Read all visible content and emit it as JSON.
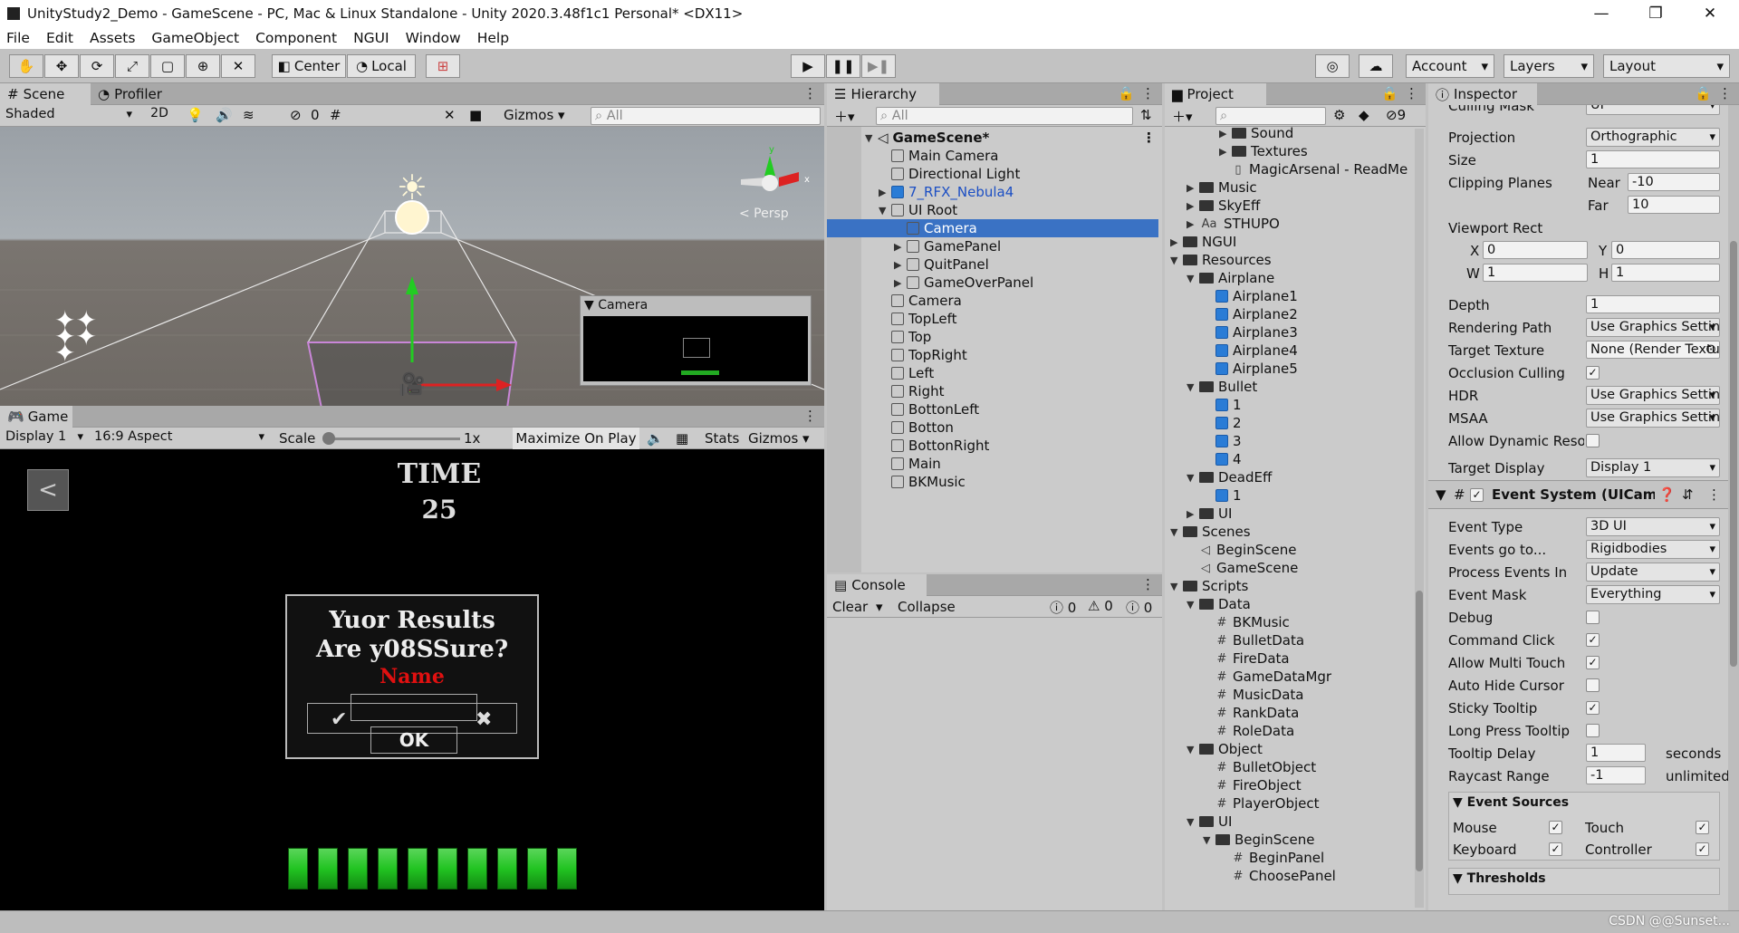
{
  "titlebar": {
    "title": "UnityStudy2_Demo - GameScene - PC, Mac & Linux Standalone - Unity 2020.3.48f1c1 Personal* <DX11>",
    "min": "—",
    "max": "❐",
    "close": "✕"
  },
  "menu": [
    "File",
    "Edit",
    "Assets",
    "GameObject",
    "Component",
    "NGUI",
    "Window",
    "Help"
  ],
  "toolbar": {
    "center": "Center",
    "local": "Local",
    "account": "Account",
    "layers": "Layers",
    "layout": "Layout",
    "play_icon": "play-icon",
    "pause_icon": "pause-icon",
    "step_icon": "step-icon"
  },
  "scene": {
    "tab_scene": "Scene",
    "tab_profiler": "Profiler",
    "shaded": "Shaded",
    "mode2d": "2D",
    "fx_count": "0",
    "gizmos": "Gizmos",
    "search_placeholder": "All",
    "persp": "< Persp",
    "camera_preview_title": "Camera"
  },
  "game": {
    "tab": "Game",
    "display": "Display 1",
    "aspect": "16:9 Aspect",
    "scale_label": "Scale",
    "scale_value": "1x",
    "maximize": "Maximize On Play",
    "stats": "Stats",
    "gizmos": "Gizmos",
    "time_label": "TIME",
    "time_value": "25",
    "results_line1": "Yuor Results",
    "results_line2": "Are y08SSure?",
    "name_label": "Name",
    "ok": "OK",
    "bars_filled": 10
  },
  "hierarchy": {
    "tab": "Hierarchy",
    "search_placeholder": "All",
    "scene_name": "GameScene*",
    "items": [
      {
        "label": "Main Camera",
        "depth": 1,
        "exp": "",
        "icon": "cube"
      },
      {
        "label": "Directional Light",
        "depth": 1,
        "exp": "",
        "icon": "cube"
      },
      {
        "label": "7_RFX_Nebula4",
        "depth": 1,
        "exp": "▶",
        "icon": "cube-blue",
        "color": "#1c4fc4"
      },
      {
        "label": "UI Root",
        "depth": 1,
        "exp": "▼",
        "icon": "cube"
      },
      {
        "label": "Camera",
        "depth": 2,
        "exp": "",
        "icon": "cube",
        "selected": true
      },
      {
        "label": "GamePanel",
        "depth": 2,
        "exp": "▶",
        "icon": "cube"
      },
      {
        "label": "QuitPanel",
        "depth": 2,
        "exp": "▶",
        "icon": "cube"
      },
      {
        "label": "GameOverPanel",
        "depth": 2,
        "exp": "▶",
        "icon": "cube"
      },
      {
        "label": "Camera",
        "depth": 1,
        "exp": "",
        "icon": "cube"
      },
      {
        "label": "TopLeft",
        "depth": 1,
        "exp": "",
        "icon": "cube"
      },
      {
        "label": "Top",
        "depth": 1,
        "exp": "",
        "icon": "cube"
      },
      {
        "label": "TopRight",
        "depth": 1,
        "exp": "",
        "icon": "cube"
      },
      {
        "label": "Left",
        "depth": 1,
        "exp": "",
        "icon": "cube"
      },
      {
        "label": "Right",
        "depth": 1,
        "exp": "",
        "icon": "cube"
      },
      {
        "label": "BottonLeft",
        "depth": 1,
        "exp": "",
        "icon": "cube"
      },
      {
        "label": "Botton",
        "depth": 1,
        "exp": "",
        "icon": "cube"
      },
      {
        "label": "BottonRight",
        "depth": 1,
        "exp": "",
        "icon": "cube"
      },
      {
        "label": "Main",
        "depth": 1,
        "exp": "",
        "icon": "cube"
      },
      {
        "label": "BKMusic",
        "depth": 1,
        "exp": "",
        "icon": "cube"
      }
    ]
  },
  "console": {
    "tab": "Console",
    "clear": "Clear",
    "collapse": "Collapse",
    "info_count": "0",
    "warn_count": "0",
    "error_count": "0"
  },
  "project": {
    "tab": "Project",
    "badge": "9",
    "items": [
      {
        "label": "Sound",
        "depth": 3,
        "exp": "▶",
        "icon": "folder"
      },
      {
        "label": "Textures",
        "depth": 3,
        "exp": "▶",
        "icon": "folder"
      },
      {
        "label": "MagicArsenal - ReadMe",
        "depth": 3,
        "exp": "",
        "icon": "doc"
      },
      {
        "label": "Music",
        "depth": 1,
        "exp": "▶",
        "icon": "folder"
      },
      {
        "label": "SkyEff",
        "depth": 1,
        "exp": "▶",
        "icon": "folder"
      },
      {
        "label": "STHUPO",
        "depth": 1,
        "exp": "▶",
        "icon": "font"
      },
      {
        "label": "NGUI",
        "depth": 0,
        "exp": "▶",
        "icon": "folder"
      },
      {
        "label": "Resources",
        "depth": 0,
        "exp": "▼",
        "icon": "folder"
      },
      {
        "label": "Airplane",
        "depth": 1,
        "exp": "▼",
        "icon": "folder"
      },
      {
        "label": "Airplane1",
        "depth": 2,
        "exp": "",
        "icon": "cube-blue"
      },
      {
        "label": "Airplane2",
        "depth": 2,
        "exp": "",
        "icon": "cube-blue"
      },
      {
        "label": "Airplane3",
        "depth": 2,
        "exp": "",
        "icon": "cube-blue"
      },
      {
        "label": "Airplane4",
        "depth": 2,
        "exp": "",
        "icon": "cube-blue"
      },
      {
        "label": "Airplane5",
        "depth": 2,
        "exp": "",
        "icon": "cube-blue"
      },
      {
        "label": "Bullet",
        "depth": 1,
        "exp": "▼",
        "icon": "folder"
      },
      {
        "label": "1",
        "depth": 2,
        "exp": "",
        "icon": "cube-blue"
      },
      {
        "label": "2",
        "depth": 2,
        "exp": "",
        "icon": "cube-blue"
      },
      {
        "label": "3",
        "depth": 2,
        "exp": "",
        "icon": "cube-blue"
      },
      {
        "label": "4",
        "depth": 2,
        "exp": "",
        "icon": "cube-blue"
      },
      {
        "label": "DeadEff",
        "depth": 1,
        "exp": "▼",
        "icon": "folder"
      },
      {
        "label": "1",
        "depth": 2,
        "exp": "",
        "icon": "cube-blue"
      },
      {
        "label": "UI",
        "depth": 1,
        "exp": "▶",
        "icon": "folder"
      },
      {
        "label": "Scenes",
        "depth": 0,
        "exp": "▼",
        "icon": "folder"
      },
      {
        "label": "BeginScene",
        "depth": 1,
        "exp": "",
        "icon": "scene"
      },
      {
        "label": "GameScene",
        "depth": 1,
        "exp": "",
        "icon": "scene"
      },
      {
        "label": "Scripts",
        "depth": 0,
        "exp": "▼",
        "icon": "folder"
      },
      {
        "label": "Data",
        "depth": 1,
        "exp": "▼",
        "icon": "folder"
      },
      {
        "label": "BKMusic",
        "depth": 2,
        "exp": "",
        "icon": "script"
      },
      {
        "label": "BulletData",
        "depth": 2,
        "exp": "",
        "icon": "script"
      },
      {
        "label": "FireData",
        "depth": 2,
        "exp": "",
        "icon": "script"
      },
      {
        "label": "GameDataMgr",
        "depth": 2,
        "exp": "",
        "icon": "script"
      },
      {
        "label": "MusicData",
        "depth": 2,
        "exp": "",
        "icon": "script"
      },
      {
        "label": "RankData",
        "depth": 2,
        "exp": "",
        "icon": "script"
      },
      {
        "label": "RoleData",
        "depth": 2,
        "exp": "",
        "icon": "script"
      },
      {
        "label": "Object",
        "depth": 1,
        "exp": "▼",
        "icon": "folder"
      },
      {
        "label": "BulletObject",
        "depth": 2,
        "exp": "",
        "icon": "script"
      },
      {
        "label": "FireObject",
        "depth": 2,
        "exp": "",
        "icon": "script"
      },
      {
        "label": "PlayerObject",
        "depth": 2,
        "exp": "",
        "icon": "script"
      },
      {
        "label": "UI",
        "depth": 1,
        "exp": "▼",
        "icon": "folder"
      },
      {
        "label": "BeginScene",
        "depth": 2,
        "exp": "▼",
        "icon": "folder"
      },
      {
        "label": "BeginPanel",
        "depth": 3,
        "exp": "",
        "icon": "script"
      },
      {
        "label": "ChoosePanel",
        "depth": 3,
        "exp": "",
        "icon": "script"
      }
    ]
  },
  "inspector": {
    "tab": "Inspector",
    "culling_mask_label": "Culling Mask",
    "culling_mask_value": "UI",
    "projection_label": "Projection",
    "projection_value": "Orthographic",
    "size_label": "Size",
    "size_value": "1",
    "clipping_label": "Clipping Planes",
    "near_label": "Near",
    "near_value": "-10",
    "far_label": "Far",
    "far_value": "10",
    "viewport_label": "Viewport Rect",
    "x_label": "X",
    "x_value": "0",
    "y_label": "Y",
    "y_value": "0",
    "w_label": "W",
    "w_value": "1",
    "h_label": "H",
    "h_value": "1",
    "depth_label": "Depth",
    "depth_value": "1",
    "rendering_path_label": "Rendering Path",
    "rendering_path_value": "Use Graphics Settings",
    "target_texture_label": "Target Texture",
    "target_texture_value": "None (Render Texture)",
    "occlusion_label": "Occlusion Culling",
    "hdr_label": "HDR",
    "hdr_value": "Use Graphics Settings",
    "msaa_label": "MSAA",
    "msaa_value": "Use Graphics Settings",
    "dynamic_label": "Allow Dynamic Resolution",
    "target_display_label": "Target Display",
    "target_display_value": "Display 1",
    "component_title": "Event System (UICamera)",
    "event_type_label": "Event Type",
    "event_type_value": "3D UI",
    "events_go_label": "Events go to...",
    "events_go_value": "Rigidbodies",
    "process_label": "Process Events In",
    "process_value": "Update",
    "event_mask_label": "Event Mask",
    "event_mask_value": "Everything",
    "debug_label": "Debug",
    "command_click_label": "Command Click",
    "multi_touch_label": "Allow Multi Touch",
    "auto_hide_label": "Auto Hide Cursor",
    "sticky_label": "Sticky Tooltip",
    "long_press_label": "Long Press Tooltip",
    "tooltip_delay_label": "Tooltip Delay",
    "tooltip_delay_value": "1",
    "seconds": "seconds",
    "raycast_label": "Raycast Range",
    "raycast_value": "-1",
    "unlimited": "unlimited",
    "event_sources_label": "Event Sources",
    "mouse": "Mouse",
    "touch": "Touch",
    "keyboard": "Keyboard",
    "controller": "Controller",
    "thresholds_label": "Thresholds"
  },
  "watermark": "CSDN @@Sunset...",
  "colors": {
    "selection": "#3a72c4",
    "play_green": "#22c422",
    "dark_bg": "#000000",
    "panel_gray": "#c2c2c2"
  }
}
